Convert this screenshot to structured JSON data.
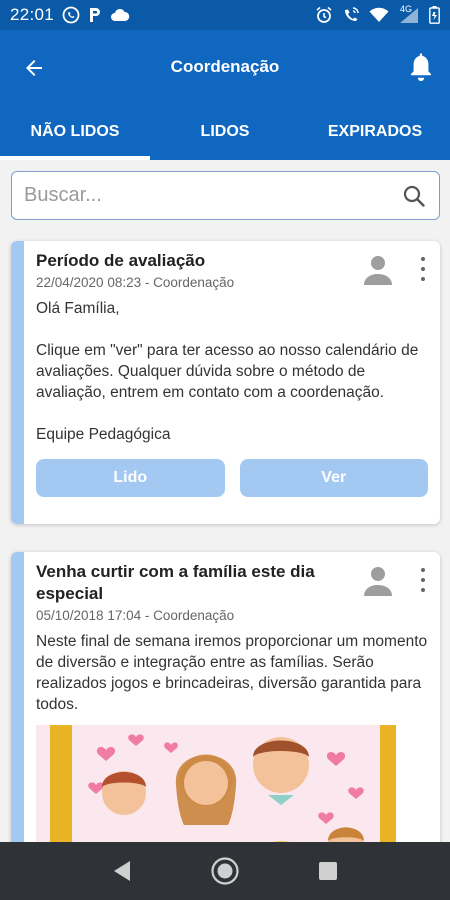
{
  "status_bar": {
    "time": "22:01",
    "network": "4G"
  },
  "app_bar": {
    "title": "Coordenação"
  },
  "tabs": [
    {
      "label": "NÃO LIDOS",
      "active": true
    },
    {
      "label": "LIDOS",
      "active": false
    },
    {
      "label": "EXPIRADOS",
      "active": false
    }
  ],
  "search": {
    "placeholder": "Buscar..."
  },
  "cards": [
    {
      "title": "Período de avaliação",
      "meta": "22/04/2020 08:23 - Coordenação",
      "body": "Olá Família,\n\nClique em \"ver\" para ter acesso ao nosso calendário de avaliações. Qualquer dúvida sobre o método de avaliação, entrem em contato com a coordenação.\n\nEquipe Pedagógica",
      "buttons": {
        "read_label": "Lido",
        "view_label": "Ver"
      }
    },
    {
      "title": "Venha curtir com a família este dia especial",
      "meta": "05/10/2018 17:04 - Coordenação",
      "body": "Neste final de semana iremos proporcionar um momento de diversão e integração entre as famílias. Serão realizados jogos e brincadeiras, diversão garantida para todos."
    }
  ],
  "colors": {
    "primary": "#0f67c0",
    "status_bar": "#0b5aa8",
    "accent_light": "#a3c9f2",
    "nav_bar": "#2f3337"
  }
}
